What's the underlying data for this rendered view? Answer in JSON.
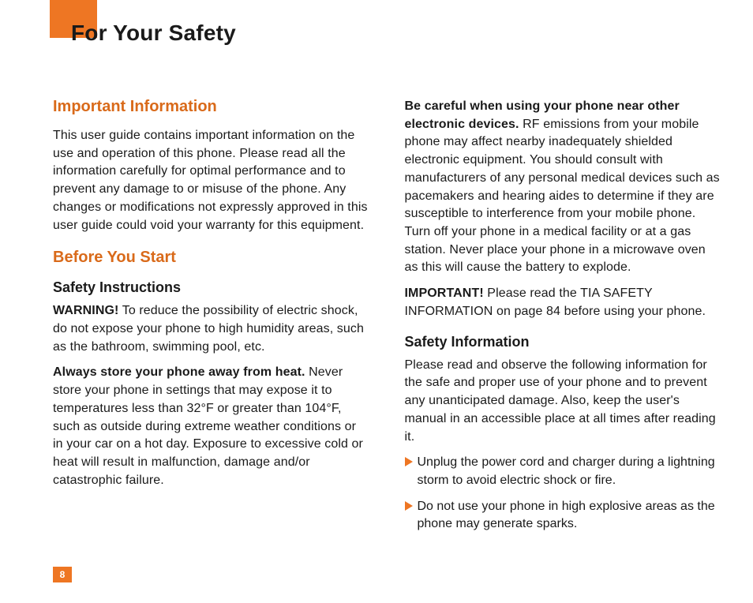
{
  "title": "For Your Safety",
  "page_number": "8",
  "col1": {
    "h1": "Important Information",
    "p1": "This user guide contains important information on the use and operation of this phone. Please read all the information carefully for optimal performance and to prevent any damage to or misuse of the phone. Any changes or modifications not expressly approved in this user guide could void your warranty for this equipment.",
    "h2": "Before You Start",
    "h3": "Safety Instructions",
    "warn_lead": "WARNING!",
    "warn_body": " To reduce the possibility of electric shock, do not expose your phone to high humidity areas, such as the bathroom, swimming pool, etc.",
    "heat_lead": "Always store your phone away from heat.",
    "heat_body": " Never store your phone in settings that may expose it to temperatures less than 32°F or greater than 104°F, such as outside during extreme weather conditions or in your car on a hot day. Exposure to excessive cold or heat will result in malfunction, damage and/or catastrophic failure."
  },
  "col2": {
    "care_lead": "Be careful when using your phone near other electronic devices.",
    "care_body": " RF emissions from your mobile phone may affect nearby inadequately shielded electronic equipment. You should consult with manufacturers of any personal medical devices such as pacemakers and hearing aides to determine if they are susceptible to interference from your mobile phone. Turn off your phone in a medical facility or at a gas station. Never place your phone in a microwave oven as this will cause the battery to explode.",
    "imp_lead": "IMPORTANT!",
    "imp_body": " Please read the TIA SAFETY INFORMATION on page 84 before using your phone.",
    "h1": "Safety Information",
    "p1": "Please read and observe the following information for the safe and proper use of your phone and to prevent any unanticipated damage. Also, keep the user's manual in an accessible place at all times after reading it.",
    "bullets": [
      "Unplug the power cord and charger during a lightning storm to avoid electric shock or fire.",
      "Do not use your phone in high explosive areas as the phone may generate sparks."
    ]
  }
}
